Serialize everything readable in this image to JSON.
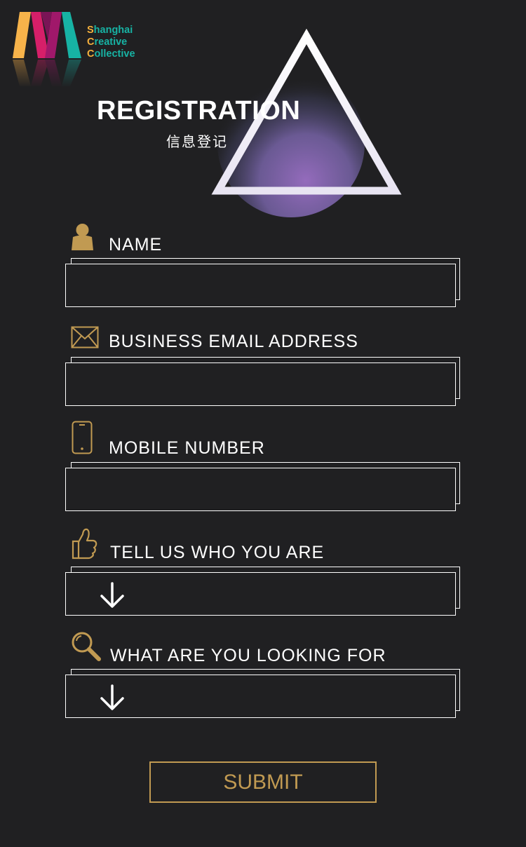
{
  "logo": {
    "lines": [
      {
        "initial": "S",
        "rest": "hanghai"
      },
      {
        "initial": "C",
        "rest": "reative"
      },
      {
        "initial": "C",
        "rest": "ollective"
      }
    ]
  },
  "hero": {
    "title": "REGISTRATION",
    "subtitle": "信息登记"
  },
  "form": {
    "name": {
      "label": "NAME",
      "icon": "person-icon",
      "value": ""
    },
    "email": {
      "label": "BUSINESS EMAIL ADDRESS",
      "icon": "envelope-icon",
      "value": ""
    },
    "mobile": {
      "label": "MOBILE NUMBER",
      "icon": "phone-icon",
      "value": ""
    },
    "who": {
      "label": "TELL US WHO YOU ARE",
      "icon": "thumbs-up-icon",
      "selected": ""
    },
    "looking": {
      "label": "WHAT ARE YOU LOOKING FOR",
      "icon": "search-icon",
      "selected": ""
    },
    "submit_label": "SUBMIT"
  },
  "colors": {
    "background": "#202022",
    "accent_gold": "#c19a52",
    "logo_teal": "#17b3a4",
    "logo_orange": "#f5b13d",
    "logo_magenta": "#d61f69"
  }
}
